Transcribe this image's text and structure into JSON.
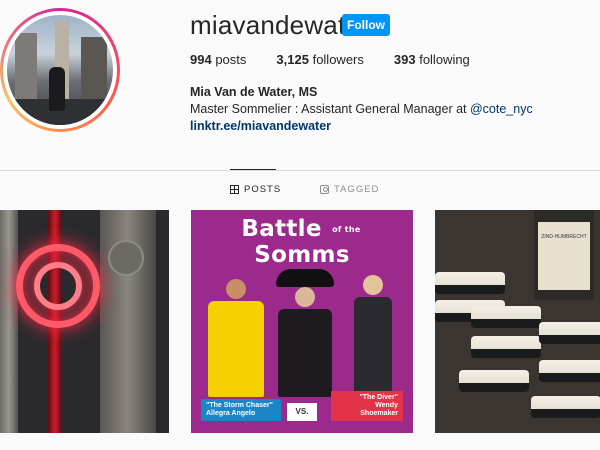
{
  "profile": {
    "username": "miavandewater",
    "follow_label": "Follow",
    "stats": {
      "posts_count": "994",
      "posts_label": "posts",
      "followers_count": "3,125",
      "followers_label": "followers",
      "following_count": "393",
      "following_label": "following"
    },
    "bio": {
      "name": "Mia Van de Water, MS",
      "line1_prefix": "Master Sommelier : Assistant General Manager at ",
      "mention": "@cote_nyc",
      "link": "linktr.ee/miavandewater"
    }
  },
  "tabs": [
    {
      "label": "POSTS",
      "icon": "grid-icon",
      "active": true
    },
    {
      "label": "TAGGED",
      "icon": "tag-icon",
      "active": false
    }
  ],
  "posts": {
    "post2": {
      "title_left": "Battle",
      "title_of": "of the",
      "title_right": "Somms",
      "left_quote": "\"The Storm Chaser\"",
      "left_name": "Allegra Angelo",
      "vs": "VS.",
      "right_quote": "\"The Diver\"",
      "right_name": "Wendy Shoemaker"
    },
    "post3": {
      "bottle_label": "ZIND-HUMBRECHT"
    }
  },
  "colors": {
    "follow_button": "#0095f6",
    "link": "#00376b",
    "post2_background": "#9b2a8c"
  }
}
